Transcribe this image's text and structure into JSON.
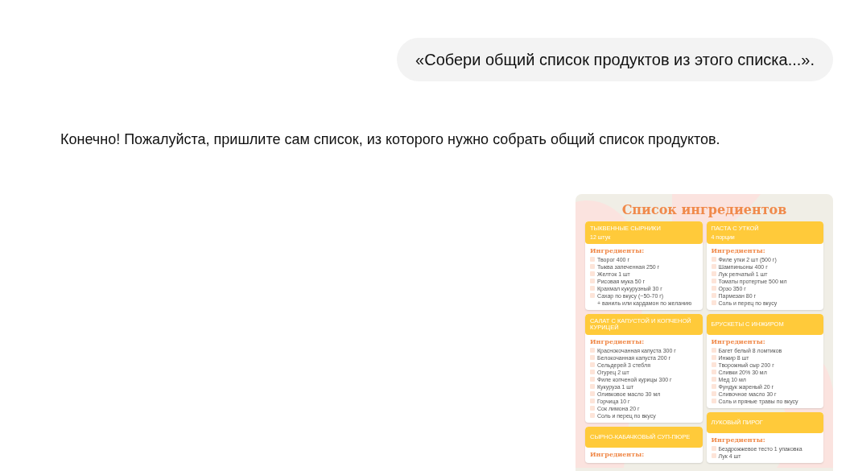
{
  "user_message": "«Собери общий список продуктов из этого списка...».",
  "assistant_message": "Конечно! Пожалуйста, пришлите сам список, из которого нужно собрать общий список продуктов.",
  "attachment": {
    "title": "Список ингредиентов",
    "columns": [
      {
        "cards": [
          {
            "name": "ТЫКВЕННЫЕ СЫРНИКИ",
            "serving": "12 штук",
            "heading": "Ингредиенты:",
            "items": [
              {
                "kind": "check",
                "checked": false,
                "text": "Творог 400 г"
              },
              {
                "kind": "check",
                "checked": false,
                "text": "Тыква запеченная 250 г"
              },
              {
                "kind": "check",
                "checked": false,
                "text": "Желток 1 шт"
              },
              {
                "kind": "check",
                "checked": false,
                "text": "Рисовая мука 50 г"
              },
              {
                "kind": "check",
                "checked": false,
                "text": "Крахмал кукурузный 30 г"
              },
              {
                "kind": "check",
                "checked": false,
                "text": "Сахар по вкусу (~50-70 г)"
              },
              {
                "kind": "note",
                "text": "+ ваниль или кардамон по желанию"
              }
            ]
          },
          {
            "name": "САЛАТ С КАПУСТОЙ И КОПЧЕНОЙ КУРИЦЕЙ",
            "heading": "Ингредиенты:",
            "items": [
              {
                "kind": "check",
                "checked": false,
                "text": "Краснокочанная капуста 300 г"
              },
              {
                "kind": "check",
                "checked": false,
                "text": "Белокочанная капуста 200 г"
              },
              {
                "kind": "check",
                "checked": false,
                "text": "Сельдерей 3 стебля"
              },
              {
                "kind": "check",
                "checked": false,
                "text": "Огурец 2 шт"
              },
              {
                "kind": "check",
                "checked": false,
                "text": "Филе копченой курицы 300 г"
              },
              {
                "kind": "check",
                "checked": false,
                "text": "Кукуруза 1 шт"
              },
              {
                "kind": "check",
                "checked": false,
                "text": "Оливковое масло 30 мл"
              },
              {
                "kind": "check",
                "checked": false,
                "text": "Горчица 10 г"
              },
              {
                "kind": "check",
                "checked": false,
                "text": "Сок лимона 20 г"
              },
              {
                "kind": "check",
                "checked": false,
                "text": "Соль и перец по вкусу"
              }
            ]
          },
          {
            "name": "СЫРНО-КАБАЧКОВЫЙ СУП-ПЮРЕ",
            "heading": "Ингредиенты:"
          }
        ]
      },
      {
        "cards": [
          {
            "name": "ПАСТА С УТКОЙ",
            "serving": "4 порции",
            "heading": "Ингредиенты:",
            "items": [
              {
                "kind": "check",
                "checked": false,
                "text": "Филе утки 2 шт (500 г)"
              },
              {
                "kind": "check",
                "checked": false,
                "text": "Шампиньоны 400 г"
              },
              {
                "kind": "check",
                "checked": false,
                "text": "Лук репчатый 1 шт"
              },
              {
                "kind": "check",
                "checked": false,
                "text": "Томаты протертые 500 мл"
              },
              {
                "kind": "check",
                "checked": false,
                "text": "Орзо 350 г"
              },
              {
                "kind": "check",
                "checked": false,
                "text": "Пармезан 80 г"
              },
              {
                "kind": "check",
                "checked": false,
                "text": "Соль и перец по вкусу"
              }
            ]
          },
          {
            "name": "БРУСКЕТЫ С ИНЖИРОМ",
            "heading": "Ингредиенты:",
            "items": [
              {
                "kind": "check",
                "checked": false,
                "text": "Багет белый 8 ломтиков"
              },
              {
                "kind": "check",
                "checked": false,
                "text": "Инжир 8 шт"
              },
              {
                "kind": "check",
                "checked": false,
                "text": "Творожный сыр 200 г"
              },
              {
                "kind": "check",
                "checked": false,
                "text": "Сливки 20% 30 мл"
              },
              {
                "kind": "check",
                "checked": false,
                "text": "Мед 10 мл"
              },
              {
                "kind": "check",
                "checked": false,
                "text": "Фундук жареный 20 г"
              },
              {
                "kind": "check",
                "checked": false,
                "text": "Сливочное масло 30 г"
              },
              {
                "kind": "check",
                "checked": false,
                "text": "Соль и пряные травы по вкусу"
              }
            ]
          },
          {
            "name": "ЛУКОВЫЙ ПИРОГ",
            "heading": "Ингредиенты:",
            "items": [
              {
                "kind": "check",
                "checked": false,
                "text": "Бездрожжевое тесто 1 упаковка"
              },
              {
                "kind": "check",
                "checked": false,
                "text": "Лук 4 шт"
              }
            ]
          }
        ]
      }
    ]
  }
}
